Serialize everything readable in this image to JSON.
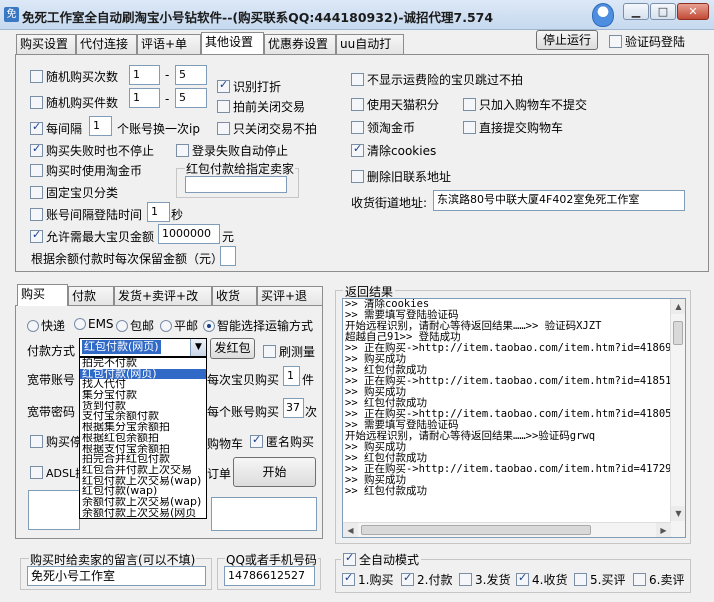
{
  "window": {
    "title": "免死工作室全自动刷淘宝小号钻软件--(购买联系QQ:444180932)-诚招代理7.574",
    "buttons": [
      "0",
      "1",
      "r"
    ]
  },
  "main_tabs": [
    "购买设置",
    "代付连接",
    "评语+单号",
    "其他设置",
    "优惠券设置",
    "uu自动打码"
  ],
  "top_buttons": {
    "stop": "停止运行",
    "captcha_label": "验证码登陆"
  },
  "settings": {
    "random_qty_label": "随机购买次数",
    "random_qty_from": "1",
    "random_qty_sep": "-",
    "random_qty_to": "5",
    "random_items_label": "随机购买件数",
    "random_items_from": "1",
    "random_items_sep": "-",
    "random_items_to": "5",
    "recognize_label": "识别打折",
    "close_trade_before_label": "拍前关闭交易",
    "every_label": "每间隔",
    "every_value": "1",
    "every_suffix": "个账号换一次ip",
    "only_close_label": "只关闭交易不拍",
    "fail_continue_label": "购买失败时也不停止",
    "login_fail_stop_label": "登录失败自动停止",
    "use_coins_label": "购买时使用淘金币",
    "redpack_group_label": "红包付款给指定卖家",
    "redpack_seller": "",
    "fixed_cat_label": "固定宝贝分类",
    "interval_label": "账号间隔登陆时间",
    "interval_value": "1",
    "interval_suffix": "秒",
    "allow_max_label": "允许需最大宝贝金额",
    "allow_max_value": "1000000",
    "allow_max_suffix": "元",
    "keep_label": "根据余额付款时每次保留金额（元）",
    "keep_value": "",
    "skip_risky_label": "不显示运费险的宝贝跳过不拍",
    "use_tmall_label": "使用天猫积分",
    "cart_only_label": "只加入购物车不提交",
    "collect_coins_label": "领淘金币",
    "submit_cart_label": "直接提交购物车",
    "clear_cookies_label": "清除cookies",
    "delete_old_label": "删除旧联系地址",
    "address_label": "收货街道地址:",
    "address_value": "东滨路80号中联大厦4F402室免死工作室"
  },
  "sub_tabs": [
    "购买",
    "付款",
    "发货+卖评+改价",
    "收货",
    "买评+退款"
  ],
  "shipping": {
    "options": [
      "快递",
      "EMS",
      "包邮",
      "平邮",
      "智能选择运输方式"
    ],
    "selected_index": 4
  },
  "payment": {
    "method_label": "付款方式",
    "method_value": "红包付款(网页)",
    "send_redpack_btn": "发红包",
    "refresh_label": "刷测量",
    "broadband_account_label": "宽带账号",
    "per_buy_label": "每次宝贝购买",
    "per_buy_value": "1",
    "per_buy_suffix": "件",
    "broadband_pwd_label": "宽带密码",
    "per_account_label": "每个账号购买",
    "per_account_value": "37",
    "per_account_suffix": "次",
    "buy_stop_label": "购买停",
    "cart_label": "购物车",
    "anon_label": "匿名购买",
    "adsl_label": "ADSL换",
    "order_label": "订单",
    "start_btn": "开始"
  },
  "dropdown_items": [
    "拍完不付款",
    "红包付款(网页)",
    "找人代付",
    "集分宝付款",
    "货到付款",
    "支付宝余额付款",
    "根据集分宝余额拍",
    "根据红包余额拍",
    "根据支付宝余额拍",
    "拍完合并红包付款",
    "红包合并付款上次交易",
    "红包付款上次交易(wap)",
    "红包付款(wap)",
    "余额付款上次交易(wap)",
    "余额付款上次交易(网页"
  ],
  "dropdown_selected": 1,
  "log": {
    "label": "返回结果",
    "lines": [
      ">> 清除cookies",
      ">> 需要填写登陆验证码",
      "开始远程识别，请耐心等待返回结果……>> 验证码XJZT",
      "超越自己91>> 登陆成功",
      ">> 正在购买->http://item.taobao.com/item.htm?id=418697",
      ">> 购买成功",
      ">> 红包付款成功",
      ">> 正在购买->http://item.taobao.com/item.htm?id=418512",
      ">> 购买成功",
      ">> 红包付款成功",
      ">> 正在购买->http://item.taobao.com/item.htm?id=418057",
      ">> 需要填写登陆验证码",
      "开始远程识别，请耐心等待返回结果……>>验证码grwq",
      ">> 购买成功",
      ">> 红包付款成功",
      ">> 正在购买->http://item.taobao.com/item.htm?id=417291",
      ">> 购买成功",
      ">> 红包付款成功"
    ]
  },
  "message": {
    "label": "购买时给卖家的留言(可以不填)",
    "value": "免死小号工作室"
  },
  "contact": {
    "label": "QQ或者手机号码",
    "value": "14786612527"
  },
  "auto_mode": {
    "label": "全自动模式",
    "steps": [
      "1.购买",
      "2.付款",
      "3.发货",
      "4.收货",
      "5.买评",
      "6.卖评"
    ],
    "checked": [
      true,
      true,
      false,
      true,
      false,
      false
    ]
  }
}
